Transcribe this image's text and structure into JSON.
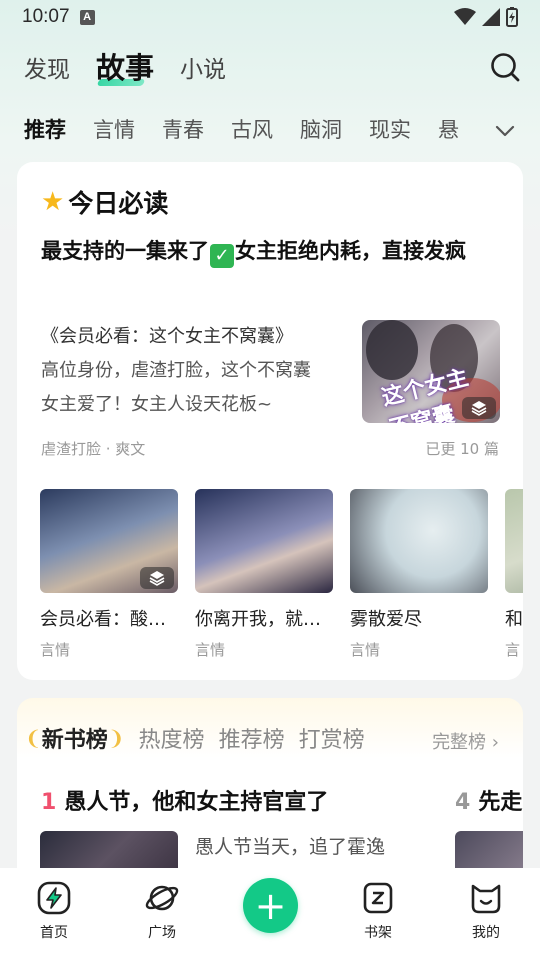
{
  "status_bar": {
    "time": "10:07",
    "notification_icon": "A"
  },
  "top_tabs": [
    {
      "label": "发现",
      "active": false
    },
    {
      "label": "故事",
      "active": true
    },
    {
      "label": "小说",
      "active": false
    }
  ],
  "category_tabs": [
    {
      "label": "推荐",
      "active": true
    },
    {
      "label": "言情",
      "active": false
    },
    {
      "label": "青春",
      "active": false
    },
    {
      "label": "古风",
      "active": false
    },
    {
      "label": "脑洞",
      "active": false
    },
    {
      "label": "现实",
      "active": false
    },
    {
      "label": "悬",
      "active": false
    }
  ],
  "daily": {
    "title": "今日必读",
    "feature": {
      "title_part1": "最支持的一集来了",
      "title_part2": "女主拒绝内耗，直接发疯",
      "line1": "《会员必看：这个女主不窝囊》",
      "line2": "高位身份，虐渣打脸，这个不窝囊",
      "line3": "女主爱了！女主人设天花板~",
      "cover_text": "这个女主 不窝囊",
      "tags": "虐渣打脸 · 爽文",
      "count": "已更 10 篇"
    },
    "books": [
      {
        "title": "会员必看：酸…",
        "genre": "言情",
        "colors": [
          "#2c3b5e",
          "#c9b7a4",
          "#6a5c66"
        ]
      },
      {
        "title": "你离开我，就…",
        "genre": "言情",
        "colors": [
          "#27325a",
          "#8b8fb8",
          "#2a2640"
        ]
      },
      {
        "title": "雾散爱尽",
        "genre": "言情",
        "colors": [
          "#c7d6dc",
          "#e6eef0",
          "#4b4f58"
        ]
      },
      {
        "title": "和",
        "genre": "言",
        "colors": [
          "#b9c7ac",
          "#d7dccb",
          "#8a9a83"
        ]
      }
    ]
  },
  "rank": {
    "tabs": [
      {
        "label": "新书榜",
        "active": true
      },
      {
        "label": "热度榜",
        "active": false
      },
      {
        "label": "推荐榜",
        "active": false
      },
      {
        "label": "打赏榜",
        "active": false
      }
    ],
    "full_label": "完整榜",
    "items": [
      {
        "num": "1",
        "title": "愚人节，他和女主持官宣了",
        "desc_line1": "愚人节当天，追了霍逸"
      },
      {
        "num": "4",
        "title": "先走"
      }
    ]
  },
  "bottom_nav": [
    {
      "label": "首页",
      "icon": "home-bolt-icon"
    },
    {
      "label": "广场",
      "icon": "planet-icon"
    },
    {
      "label": "+",
      "icon": "plus-icon"
    },
    {
      "label": "书架",
      "icon": "bookshelf-icon"
    },
    {
      "label": "我的",
      "icon": "cat-face-icon"
    }
  ],
  "colors": {
    "accent": "#13c987",
    "rank_num": "#f0506e",
    "star": "#f7b81c"
  }
}
